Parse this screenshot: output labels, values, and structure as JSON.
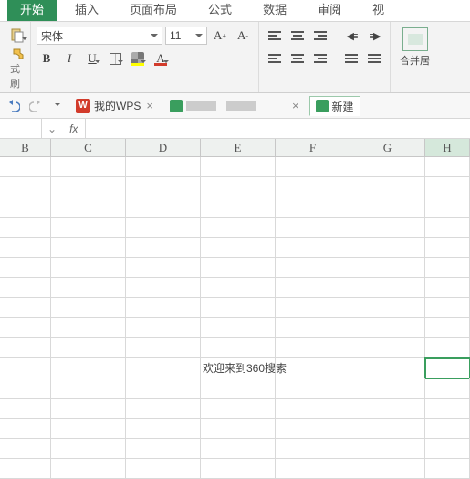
{
  "ribbon_tabs": {
    "home": "开始",
    "insert": "插入",
    "layout": "页面布局",
    "formula": "公式",
    "data": "数据",
    "review": "审阅",
    "view": "视"
  },
  "font": {
    "name": "宋体",
    "size": "11",
    "bold": "B",
    "italic": "I",
    "underline": "U",
    "grow": "A",
    "grow_sup": "+",
    "shrink": "A",
    "shrink_sup": "-",
    "fontcolor_letter": "A"
  },
  "clipboard": {
    "paste_fmt": "式刷"
  },
  "merge": {
    "label": "合并居"
  },
  "doc_tabs": {
    "wps_logo": "W",
    "wps_label": "我的WPS",
    "doc2_label": "",
    "new_label": "新建"
  },
  "formula_bar": {
    "name_box": "",
    "fx_label": "fx",
    "input": ""
  },
  "columns": {
    "B": "B",
    "C": "C",
    "D": "D",
    "E": "E",
    "F": "F",
    "G": "G",
    "H": "H"
  },
  "cells": {
    "welcome_text": "欢迎来到360搜索"
  },
  "indent": {
    "dec": "◀≡",
    "inc": "≡▶"
  }
}
